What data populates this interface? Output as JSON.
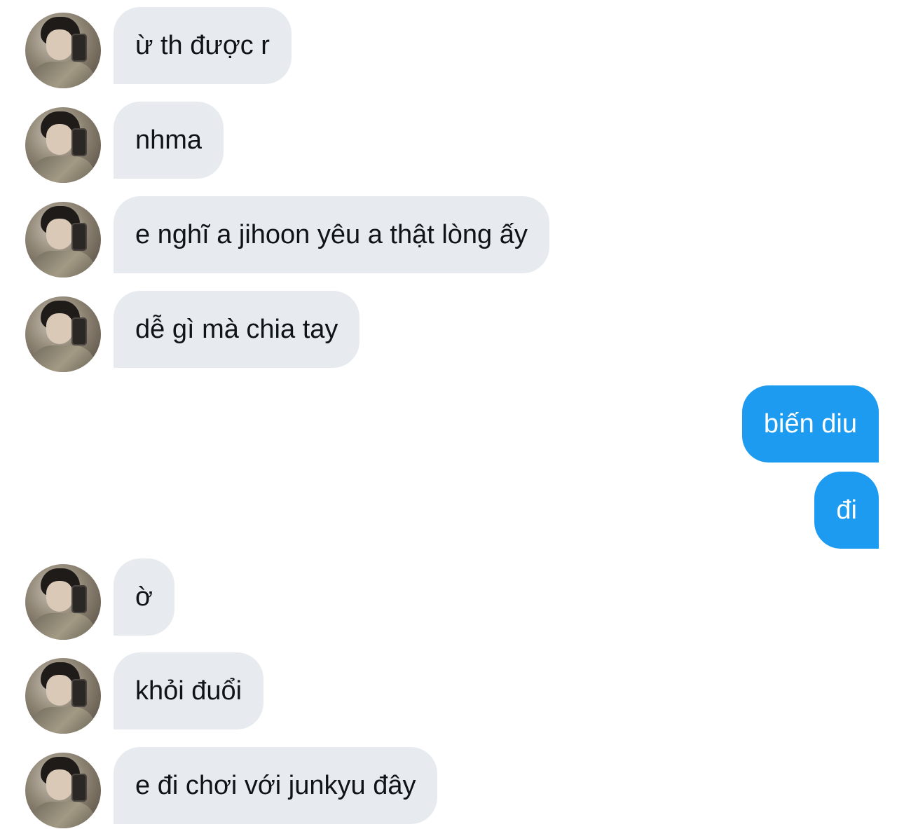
{
  "messages": [
    {
      "side": "in",
      "text": "ừ th được r"
    },
    {
      "side": "in",
      "text": "nhma"
    },
    {
      "side": "in",
      "text": "e nghĩ a jihoon yêu a thật lòng ấy"
    },
    {
      "side": "in",
      "text": "dễ gì mà chia tay"
    },
    {
      "side": "out",
      "text": "biến diu"
    },
    {
      "side": "out",
      "text": "đi"
    },
    {
      "side": "in",
      "text": "ờ"
    },
    {
      "side": "in",
      "text": "khỏi đuổi"
    },
    {
      "side": "in",
      "text": "e đi chơi với junkyu đây"
    }
  ],
  "colors": {
    "incoming_bubble": "#e7ebef",
    "incoming_text": "#0f1419",
    "outgoing_bubble": "#1d9bf0",
    "outgoing_text": "#ffffff"
  }
}
